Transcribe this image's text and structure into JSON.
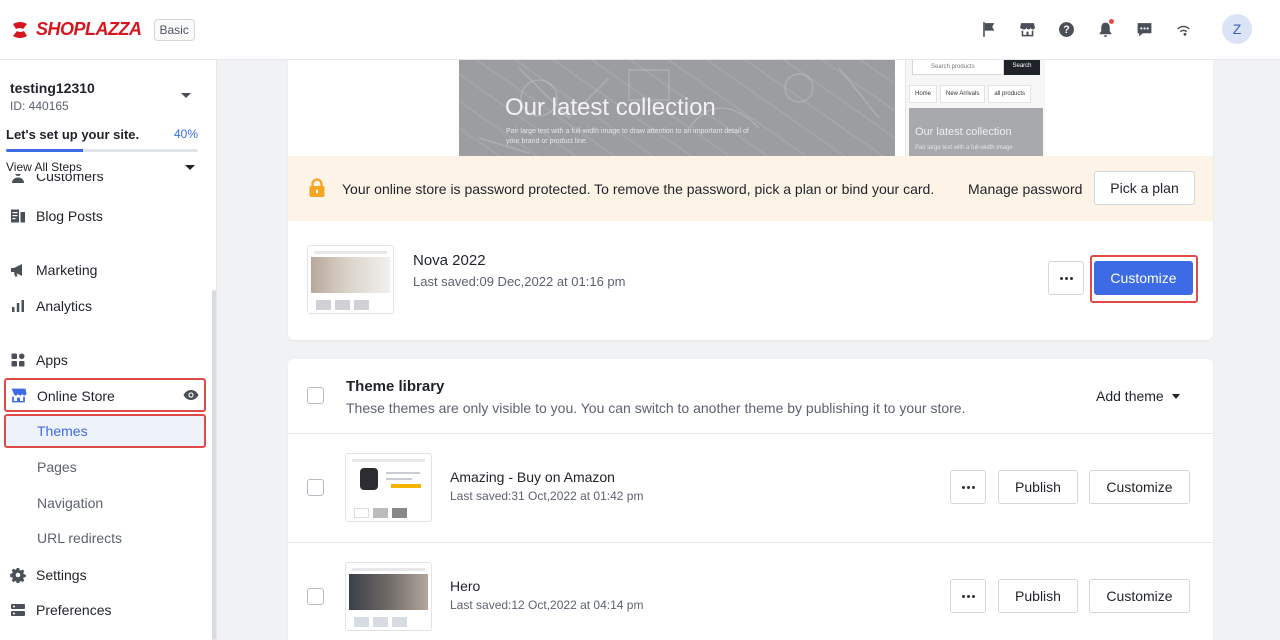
{
  "brand": {
    "name": "SHOPLAZZA",
    "plan": "Basic",
    "accent": "#3d6be5",
    "logo_color": "#d6161e"
  },
  "topbar": {
    "icons": [
      "flag-icon",
      "store-icon",
      "help-icon",
      "bell-icon",
      "chat-icon",
      "wifi-icon"
    ],
    "avatar_initial": "Z"
  },
  "store": {
    "name": "testing12310",
    "id": "ID: 440165"
  },
  "setup": {
    "title": "Let's set up your site.",
    "percent": "40%",
    "progress": 0.4,
    "view_steps": "View All Steps"
  },
  "sidebar": {
    "items": [
      {
        "label": "Customers",
        "icon": "customers-icon"
      },
      {
        "label": "Blog Posts",
        "icon": "blog-icon"
      },
      {
        "label": "Marketing",
        "icon": "megaphone-icon"
      },
      {
        "label": "Analytics",
        "icon": "analytics-icon"
      },
      {
        "label": "Apps",
        "icon": "apps-icon"
      },
      {
        "label": "Online Store",
        "icon": "store-icon"
      },
      {
        "label": "Settings",
        "icon": "gear-icon"
      },
      {
        "label": "Preferences",
        "icon": "preferences-icon"
      }
    ],
    "sub_items": [
      "Themes",
      "Pages",
      "Navigation",
      "URL redirects"
    ]
  },
  "preview": {
    "headline": "Our latest collection",
    "subtext": "Pair large text with a full-width image to draw attention to an important detail of your brand or product line.",
    "mobile_search_placeholder": "Search products",
    "mobile_search_button": "Search",
    "mobile_links": [
      "Home",
      "New Arrivals",
      "all products"
    ],
    "mobile_headline": "Our latest collection",
    "mobile_subtext": "Pair large text with a full-width image"
  },
  "password_banner": {
    "text": "Your online store is password protected. To remove the password, pick a plan or bind your card.",
    "manage_label": "Manage password",
    "pick_plan_label": "Pick a plan"
  },
  "current_theme": {
    "name": "Nova 2022",
    "saved": "Last saved:09 Dec,2022 at 01:16 pm",
    "customize_label": "Customize"
  },
  "library": {
    "title": "Theme library",
    "description": "These themes are only visible to you. You can switch to another theme by publishing it to your store.",
    "add_theme_label": "Add theme",
    "themes": [
      {
        "name": "Amazing - Buy on Amazon",
        "saved": "Last saved:31 Oct,2022 at 01:42 pm",
        "publish_label": "Publish",
        "customize_label": "Customize"
      },
      {
        "name": "Hero",
        "saved": "Last saved:12 Oct,2022 at 04:14 pm",
        "publish_label": "Publish",
        "customize_label": "Customize"
      }
    ]
  }
}
